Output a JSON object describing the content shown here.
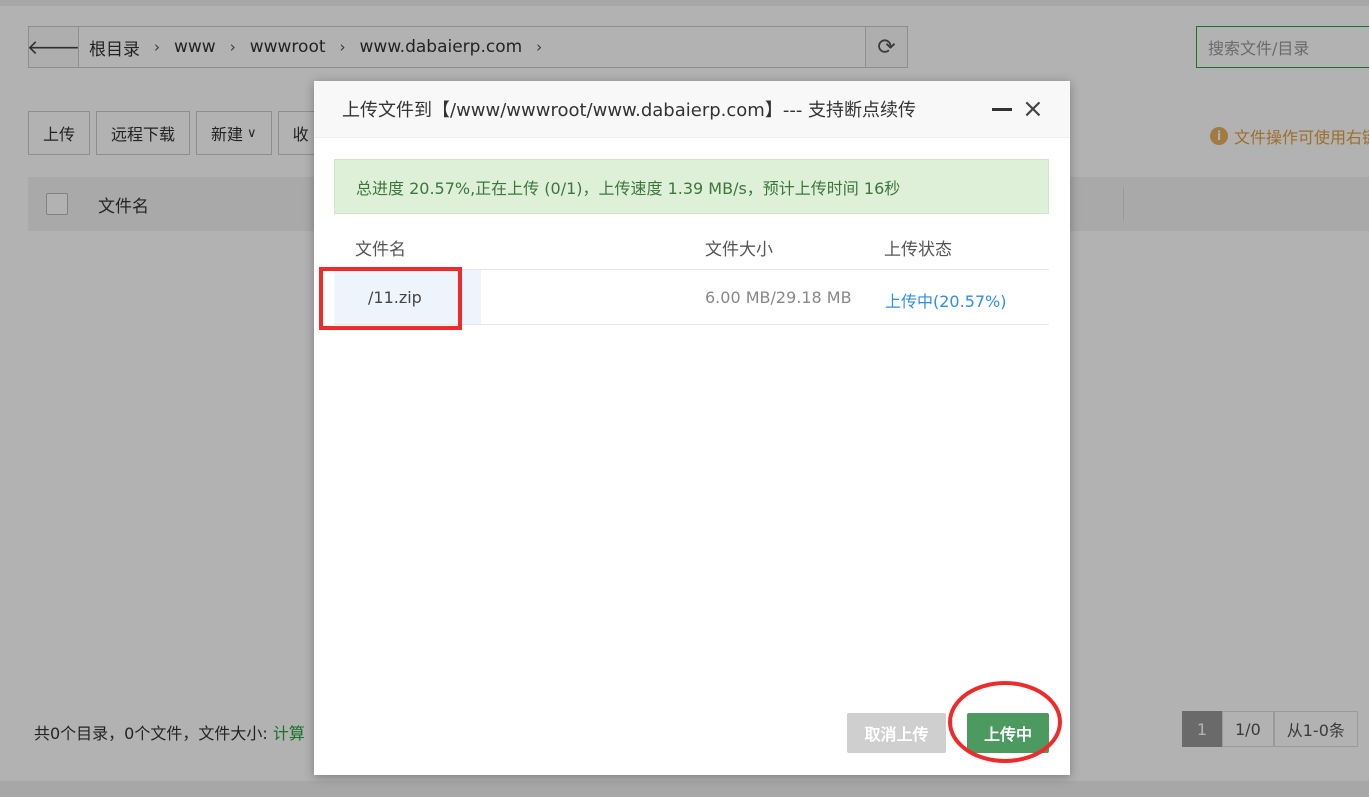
{
  "background": {
    "path": {
      "back_icon": "arrow-left-icon",
      "crumbs": [
        "根目录",
        "www",
        "wwwroot",
        "www.dabaierp.com"
      ],
      "separator": "›",
      "refresh_icon": "refresh-icon"
    },
    "search": {
      "placeholder": "搜索文件/目录"
    },
    "toolbar": {
      "upload": "上传",
      "remote_download": "远程下载",
      "new": "新建",
      "new_caret": "∨",
      "partial": "收"
    },
    "tip": {
      "icon": "i",
      "text": "文件操作可使用右键"
    },
    "table": {
      "col_name": "文件名"
    },
    "footer": {
      "summary": "共0个目录，0个文件，文件大小:",
      "calc": "计算"
    },
    "pager": {
      "current": "1",
      "pages": "1/0",
      "range": "从1-0条"
    }
  },
  "modal": {
    "title": "上传文件到【/www/wwwroot/www.dabaierp.com】--- 支持断点续传",
    "close_icon": "×",
    "progress_text": "总进度 20.57%,正在上传 (0/1)，上传速度 1.39 MB/s，预计上传时间 16秒",
    "progress": 0.2057,
    "columns": {
      "name": "文件名",
      "size": "文件大小",
      "status": "上传状态"
    },
    "files": [
      {
        "name": "/11.zip",
        "size": "6.00 MB/29.18 MB",
        "status": "上传中(20.57%)"
      }
    ],
    "buttons": {
      "cancel": "取消上传",
      "uploading": "上传中"
    }
  },
  "colors": {
    "accent_green": "#20a53a",
    "status_blue": "#2e8ded",
    "highlight_red": "#ee2a2a"
  }
}
